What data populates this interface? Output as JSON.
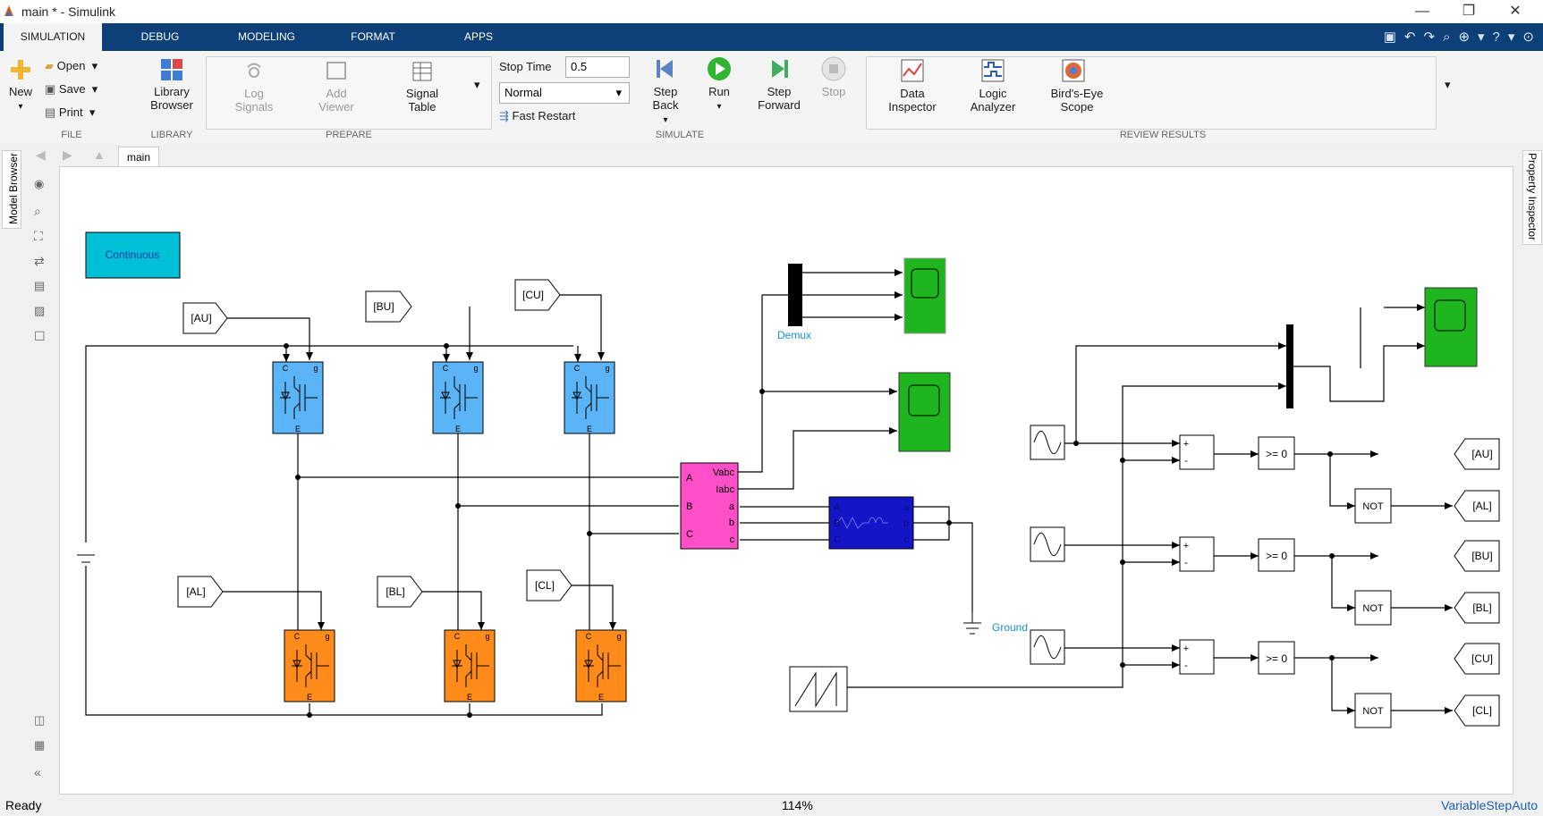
{
  "window": {
    "title": "main * - Simulink",
    "minimize": "—",
    "restore": "❐",
    "close": "✕"
  },
  "tabs": [
    "SIMULATION",
    "DEBUG",
    "MODELING",
    "FORMAT",
    "APPS"
  ],
  "ribbon": {
    "file": {
      "new": "New",
      "open": "Open",
      "save": "Save",
      "print": "Print",
      "label": "FILE"
    },
    "library": {
      "browser": "Library Browser",
      "label": "LIBRARY"
    },
    "prepare": {
      "log": "Log Signals",
      "viewer": "Add Viewer",
      "table": "Signal Table",
      "label": "PREPARE"
    },
    "simulate": {
      "stop_time_label": "Stop Time",
      "stop_time": "0.5",
      "mode": "Normal",
      "fast_restart": "Fast Restart",
      "step_back": "Step Back",
      "run": "Run",
      "step_forward": "Step Forward",
      "stop": "Stop",
      "label": "SIMULATE"
    },
    "review": {
      "inspector": "Data Inspector",
      "logic": "Logic Analyzer",
      "birds": "Bird's-Eye Scope",
      "label": "REVIEW RESULTS"
    }
  },
  "breadcrumb": {
    "tab": "main"
  },
  "side": {
    "model_browser": "Model Browser",
    "property_inspector": "Property Inspector"
  },
  "diagram": {
    "continuous": "Continuous",
    "goto_upper": [
      "[AU]",
      "[BU]",
      "[CU]"
    ],
    "goto_lower": [
      "[AL]",
      "[BL]",
      "[CL]"
    ],
    "demux": "Demux",
    "ground": "Ground",
    "measure_ports": [
      "A",
      "B",
      "C",
      "Vabc",
      "Iabc",
      "a",
      "b",
      "c"
    ],
    "load_ports": [
      "A",
      "B",
      "C",
      "a",
      "b",
      "c"
    ],
    "compare": [
      ">= 0",
      ">= 0",
      ">= 0"
    ],
    "not": [
      "NOT",
      "NOT",
      "NOT"
    ],
    "out_tags": [
      "[AU]",
      "[AL]",
      "[BU]",
      "[BL]",
      "[CU]",
      "[CL]"
    ],
    "sum_signs": [
      "+",
      "-"
    ],
    "igbt_ports": [
      "C",
      "g",
      "E"
    ]
  },
  "status": {
    "state": "Ready",
    "zoom": "114%",
    "solver": "VariableStepAuto"
  },
  "colors": {
    "accent": "#0d3f78",
    "igbt_upper": "#5ab4f5",
    "igbt_lower": "#ff8c1a",
    "scope": "#1fb51f",
    "measure": "#ff4fc8",
    "load": "#1515c8",
    "continuous": "#00c0d8"
  }
}
